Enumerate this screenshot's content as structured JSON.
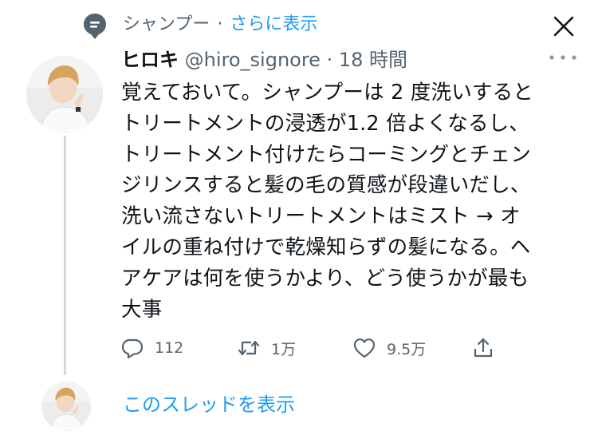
{
  "topic": {
    "name": "シャンプー",
    "separator": "·",
    "link_label": "さらに表示"
  },
  "tweet": {
    "author_name": "ヒロキ",
    "handle": "@hiro_signore",
    "separator": "·",
    "time": "18 時間",
    "text_lines": [
      "覚えておいて。シャンプーは 2 度洗いすると",
      "トリートメントの浸透が1.2 倍よくなるし、",
      "トリートメント付けたらコーミングとチェン",
      "ジリンスすると髪の毛の質感が段違いだし、",
      "洗い流さないトリートメントはミスト → オ",
      "イルの重ね付けで乾燥知らずの髪になる。ヘ",
      "アケアは何を使うかより、どう使うかが最も",
      "大事"
    ]
  },
  "actions": {
    "reply_count": "112",
    "retweet_count": "1万",
    "like_count": "9.5万"
  },
  "thread": {
    "show_label": "このスレッドを表示"
  },
  "icons": {
    "topic": "topic-icon",
    "close": "close-icon",
    "more": "more-icon",
    "reply": "reply-icon",
    "retweet": "retweet-icon",
    "like": "like-icon",
    "share": "share-icon"
  },
  "colors": {
    "accent": "#1d9bf0",
    "secondary_text": "#536471",
    "primary_text": "#0f1419",
    "thread_line": "#cfd9de"
  }
}
